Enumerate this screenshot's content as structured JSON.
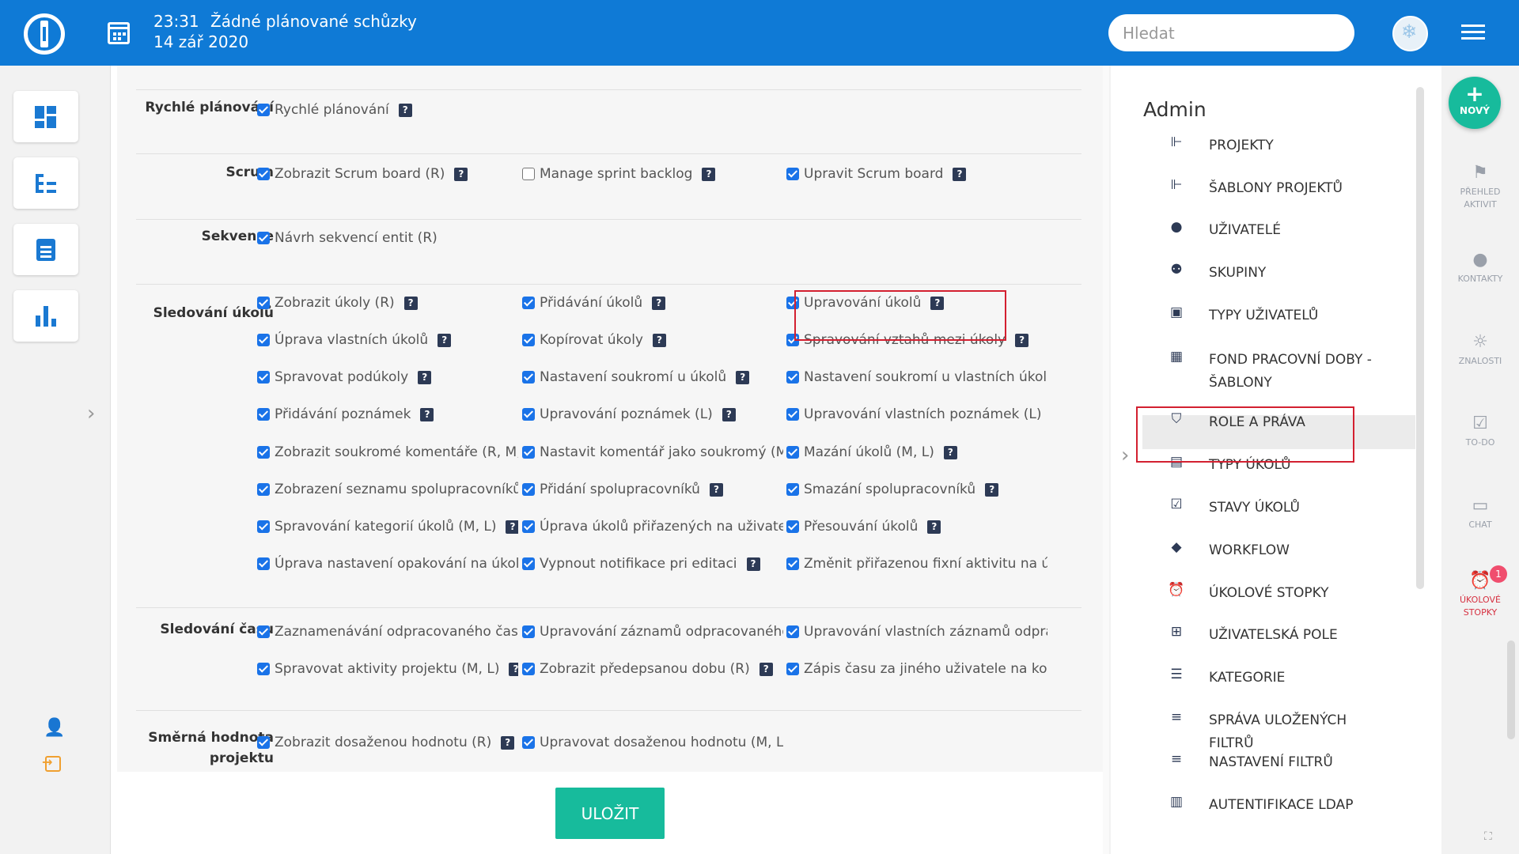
{
  "header": {
    "time": "23:31",
    "meetings": "Žádné plánované schůzky",
    "date": "14 zář 2020",
    "search_placeholder": "Hledat",
    "brand_color": "#0f7ad6"
  },
  "sidebar": {
    "items": [
      {
        "icon": "dashboard-icon"
      },
      {
        "icon": "project-tree-icon"
      },
      {
        "icon": "tasks-clipboard-icon"
      },
      {
        "icon": "reports-bar-chart-icon"
      }
    ],
    "bottom_icons": [
      "add-user-icon",
      "sign-in-icon"
    ]
  },
  "sections": [
    {
      "label": "Rychlé plánování",
      "items": [
        {
          "label": "Rychlé plánování",
          "checked": true,
          "help": true
        }
      ]
    },
    {
      "label": "Scrum",
      "items": [
        {
          "label": "Zobrazit Scrum board (R)",
          "checked": true,
          "help": true
        },
        {
          "label": "Manage sprint backlog",
          "checked": false,
          "help": true
        },
        {
          "label": "Upravit Scrum board",
          "checked": true,
          "help": true
        }
      ]
    },
    {
      "label": "Sekvence",
      "items": [
        {
          "label": "Návrh sekvencí entit (R)",
          "checked": true,
          "help": false
        }
      ]
    },
    {
      "label": "Sledování úkolů",
      "items": [
        {
          "label": "Zobrazit úkoly (R)",
          "checked": true,
          "help": true
        },
        {
          "label": "Přidávání úkolů",
          "checked": true,
          "help": true
        },
        {
          "label": "Upravování úkolů",
          "checked": true,
          "help": true
        },
        {
          "label": "Úprava vlastních úkolů",
          "checked": true,
          "help": true
        },
        {
          "label": "Kopírovat úkoly",
          "checked": true,
          "help": true
        },
        {
          "label": "Spravování vztahů mezi úkoly",
          "checked": true,
          "help": true
        },
        {
          "label": "Spravovat podúkoly",
          "checked": true,
          "help": true
        },
        {
          "label": "Nastavení soukromí u úkolů",
          "checked": true,
          "help": true
        },
        {
          "label": "Nastavení soukromí u vlastních úkolů",
          "checked": true,
          "help": false
        },
        {
          "label": "Přidávání poznámek",
          "checked": true,
          "help": true
        },
        {
          "label": "Upravování poznámek (L)",
          "checked": true,
          "help": true
        },
        {
          "label": "Upravování vlastních poznámek (L)",
          "checked": true,
          "help": true
        },
        {
          "label": "Zobrazit soukromé komentáře (R, M,",
          "checked": true,
          "help": false
        },
        {
          "label": "Nastavit komentář jako soukromý (M,",
          "checked": true,
          "help": false
        },
        {
          "label": "Mazání úkolů (M, L)",
          "checked": true,
          "help": true
        },
        {
          "label": "Zobrazení seznamu spolupracovníků (",
          "checked": true,
          "help": false
        },
        {
          "label": "Přidání spolupracovníků",
          "checked": true,
          "help": true
        },
        {
          "label": "Smazání spolupracovníků",
          "checked": true,
          "help": true
        },
        {
          "label": "Spravování kategorií úkolů (M, L)",
          "checked": true,
          "help": true
        },
        {
          "label": "Úprava úkolů přiřazených na uživatele",
          "checked": true,
          "help": false
        },
        {
          "label": "Přesouvání úkolů",
          "checked": true,
          "help": true
        },
        {
          "label": "Úprava nastavení opakování na úkole",
          "checked": true,
          "help": false
        },
        {
          "label": "Vypnout notifikace pri editaci",
          "checked": true,
          "help": true
        },
        {
          "label": "Změnit přiřazenou fixní aktivitu na úk",
          "checked": true,
          "help": false
        }
      ]
    },
    {
      "label": "Sledování času",
      "items": [
        {
          "label": "Zaznamenávání odpracovaného času",
          "checked": true,
          "help": false
        },
        {
          "label": "Upravování záznamů odpracovaného",
          "checked": true,
          "help": false
        },
        {
          "label": "Upravování vlastních záznamů odprac",
          "checked": true,
          "help": false
        },
        {
          "label": "Spravovat aktivity projektu (M, L)",
          "checked": true,
          "help": true
        },
        {
          "label": "Zobrazit předepsanou dobu (R)",
          "checked": true,
          "help": true
        },
        {
          "label": "Zápis času za jiného uživatele na konk",
          "checked": true,
          "help": false
        }
      ]
    },
    {
      "label": "Směrná hodnota projektu",
      "items": [
        {
          "label": "Zobrazit dosaženou hodnotu (R)",
          "checked": true,
          "help": true
        },
        {
          "label": "Upravovat dosaženou hodnotu (M, L)",
          "checked": true,
          "help": false
        }
      ]
    }
  ],
  "help_glyph": "?",
  "save_label": "ULOŽIT",
  "admin": {
    "title": "Admin",
    "items": [
      {
        "label": "PROJEKTY",
        "icon": "project-tree-icon"
      },
      {
        "label": "ŠABLONY PROJEKTŮ",
        "icon": "project-tree-icon"
      },
      {
        "label": "UŽIVATELÉ",
        "icon": "user-icon"
      },
      {
        "label": "SKUPINY",
        "icon": "group-icon"
      },
      {
        "label": "TYPY UŽIVATELŮ",
        "icon": "user-badge-icon"
      },
      {
        "label": "FOND PRACOVNÍ DOBY - ŠABLONY",
        "icon": "calendar-icon"
      },
      {
        "label": "ROLE A PRÁVA",
        "icon": "shield-user-icon",
        "active": true
      },
      {
        "label": "TYPY ÚKOLŮ",
        "icon": "clipboard-icon"
      },
      {
        "label": "STAVY ÚKOLŮ",
        "icon": "clipboard-check-icon"
      },
      {
        "label": "WORKFLOW",
        "icon": "diamond-direction-icon"
      },
      {
        "label": "ÚKOLOVÉ STOPKY",
        "icon": "alarm-clock-icon"
      },
      {
        "label": "UŽIVATELSKÁ POLE",
        "icon": "plus-box-icon"
      },
      {
        "label": "KATEGORIE",
        "icon": "list-icon"
      },
      {
        "label": "SPRÁVA ULOŽENÝCH FILTRŮ",
        "icon": "filter-icon"
      },
      {
        "label": "NASTAVENÍ FILTRŮ",
        "icon": "filter-icon"
      },
      {
        "label": "AUTENTIFIKACE LDAP",
        "icon": "server-icon"
      }
    ]
  },
  "rail": {
    "new_label": "NOVÝ",
    "items": [
      {
        "label": "PŘEHLED AKTIVIT",
        "icon": "flag-icon"
      },
      {
        "label": "KONTAKTY",
        "icon": "contact-icon"
      },
      {
        "label": "ZNALOSTI",
        "icon": "lightbulb-icon"
      },
      {
        "label": "TO-DO",
        "icon": "checklist-icon"
      },
      {
        "label": "CHAT",
        "icon": "chat-icon"
      },
      {
        "label": "ÚKOLOVÉ STOPKY",
        "icon": "alarm-clock-icon",
        "badge": "1"
      }
    ]
  },
  "colors": {
    "accent": "#0f7ad6",
    "save": "#17bb9c",
    "highlight": "#d32030",
    "checkbox": "#1a73e8"
  }
}
